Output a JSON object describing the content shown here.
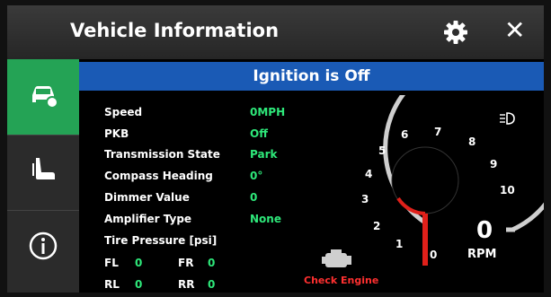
{
  "header": {
    "title": "Vehicle Information"
  },
  "banner": {
    "text": "Ignition is Off"
  },
  "info": [
    {
      "label": "Speed",
      "value": "0MPH"
    },
    {
      "label": "PKB",
      "value": "Off"
    },
    {
      "label": "Transmission State",
      "value": "Park"
    },
    {
      "label": "Compass Heading",
      "value": "0°"
    },
    {
      "label": "Dimmer Value",
      "value": "0"
    },
    {
      "label": "Amplifier Type",
      "value": "None"
    }
  ],
  "tire": {
    "label": "Tire Pressure [psi]",
    "fl_label": "FL",
    "fl": "0",
    "fr_label": "FR",
    "fr": "0",
    "rl_label": "RL",
    "rl": "0",
    "rr_label": "RR",
    "rr": "0"
  },
  "gauge": {
    "ticks": [
      "0",
      "1",
      "2",
      "3",
      "4",
      "5",
      "6",
      "7",
      "8",
      "9",
      "10"
    ],
    "value": "0",
    "unit": "RPM"
  },
  "warnings": {
    "check_engine": "Check Engine"
  },
  "colors": {
    "active_tab": "#24a355",
    "banner": "#1a5ab5",
    "value_text": "#2ee87a",
    "needle": "#e0201a"
  },
  "icons": [
    "car-info-icon",
    "seat-icon",
    "info-icon",
    "gear-icon",
    "close-icon",
    "headlight-icon",
    "engine-icon"
  ]
}
